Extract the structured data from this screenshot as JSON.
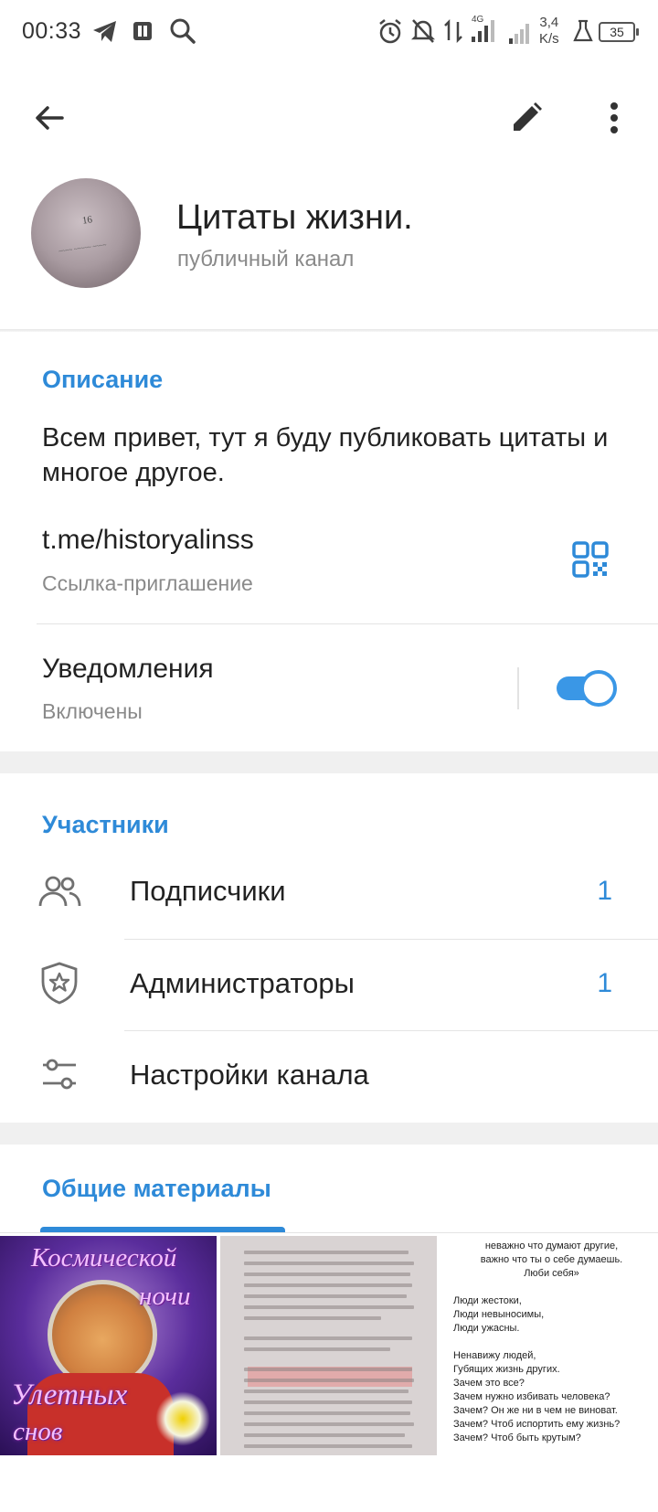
{
  "status_bar": {
    "time": "00:33",
    "network": "4G",
    "speed_value": "3,4",
    "speed_unit": "K/s",
    "battery": "35"
  },
  "toolbar": {
    "back_icon": "arrow-left",
    "edit_icon": "pencil",
    "more_icon": "dots-vertical"
  },
  "channel": {
    "title": "Цитаты жизни.",
    "subtitle": "публичный канал"
  },
  "info": {
    "section_title": "Описание",
    "description": "Всем привет, тут я буду публиковать цитаты и многое другое.",
    "link": "t.me/historyalinss",
    "link_caption": "Ссылка-приглашение",
    "notifications_label": "Уведомления",
    "notifications_state": "Включены",
    "notifications_on": true
  },
  "participants": {
    "section_title": "Участники",
    "rows": [
      {
        "label": "Подписчики",
        "count": "1",
        "icon": "users-icon"
      },
      {
        "label": "Администраторы",
        "count": "1",
        "icon": "shield-star-icon"
      },
      {
        "label": "Настройки канала",
        "count": "",
        "icon": "sliders-icon"
      }
    ]
  },
  "shared_media": {
    "tab_label": "Общие материалы",
    "items": [
      {
        "kind": "image",
        "caption_lines": [
          "Космической",
          "ночи",
          "Улетных",
          "снов"
        ]
      },
      {
        "kind": "image",
        "caption_lines": []
      },
      {
        "kind": "image",
        "caption_lines": [
          "неважно что думают другие,",
          "важно что ты о себе думаешь.",
          "Люби себя»",
          "Люди жестоки,",
          "Люди невыносимы,",
          "Люди ужасны.",
          "Ненавижу людей,",
          "Губящих жизнь других.",
          "Зачем это все?",
          "Зачем нужно избивать человека?",
          "Зачем? Он же ни в чем не виноват.",
          "Зачем? Чтоб испортить ему жизнь?",
          "Зачем? Чтоб быть крутым?"
        ]
      }
    ]
  },
  "colors": {
    "accent": "#2e8ad8",
    "toggle": "#3a97e6",
    "secondary_text": "#8a8a8a"
  }
}
